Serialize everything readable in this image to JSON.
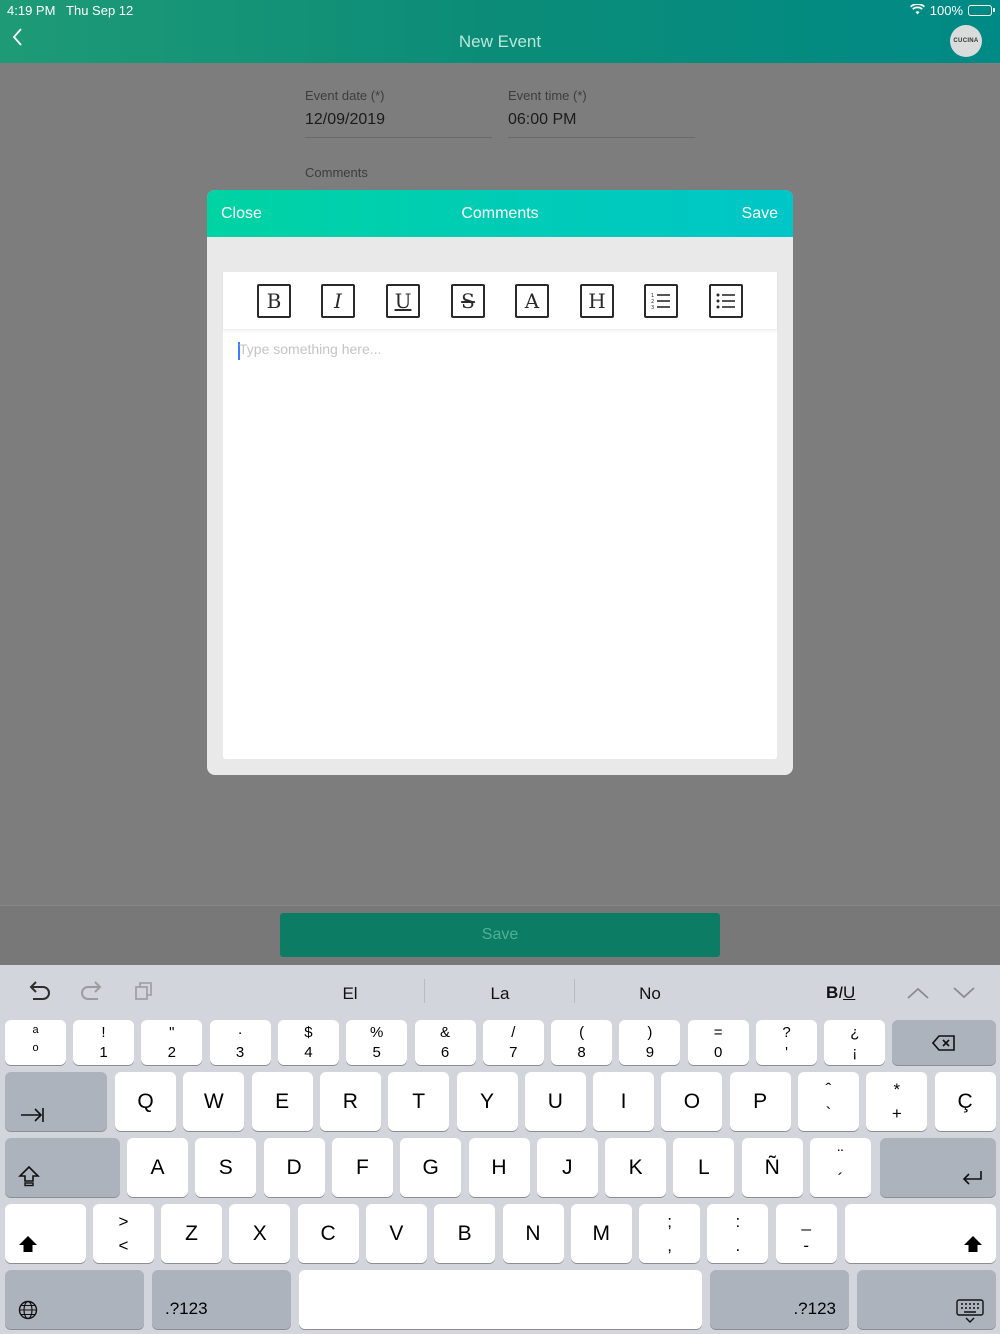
{
  "status_bar": {
    "time": "4:19 PM",
    "date": "Thu Sep 12",
    "battery": "100%"
  },
  "header": {
    "title": "New Event",
    "avatar_text": "CUCINA"
  },
  "form": {
    "event_date_label": "Event date (*)",
    "event_date_value": "12/09/2019",
    "event_time_label": "Event time (*)",
    "event_time_value": "06:00 PM",
    "comments_label": "Comments"
  },
  "modal": {
    "close_label": "Close",
    "title": "Comments",
    "save_label": "Save",
    "toolbar": [
      "B",
      "I",
      "U",
      "S",
      "A",
      "H",
      "ordered-list",
      "bullet-list"
    ],
    "placeholder": "Type something here..."
  },
  "bottom": {
    "save_label": "Save"
  },
  "keyboard": {
    "suggestions": [
      "El",
      "La",
      "No"
    ],
    "format_label": "BIU",
    "space_label": "",
    "numbers_label": ".?123",
    "row1": [
      {
        "top": "a\no",
        "bot": ""
      },
      {
        "top": "!",
        "bot": "1"
      },
      {
        "top": "\"",
        "bot": "2"
      },
      {
        "top": "·",
        "bot": "3"
      },
      {
        "top": "$",
        "bot": "4"
      },
      {
        "top": "%",
        "bot": "5"
      },
      {
        "top": "&",
        "bot": "6"
      },
      {
        "top": "/",
        "bot": "7"
      },
      {
        "top": "(",
        "bot": "8"
      },
      {
        "top": ")",
        "bot": "9"
      },
      {
        "top": "=",
        "bot": "0"
      },
      {
        "top": "?",
        "bot": "'"
      },
      {
        "top": "¿",
        "bot": "¡"
      }
    ],
    "row2": [
      "Q",
      "W",
      "E",
      "R",
      "T",
      "Y",
      "U",
      "I",
      "O",
      "P"
    ],
    "row2_extra": [
      {
        "top": "ˆ",
        "bot": "`"
      },
      {
        "top": "*",
        "bot": "+"
      },
      {
        "top": "",
        "bot": "Ç"
      }
    ],
    "row3": [
      "A",
      "S",
      "D",
      "F",
      "G",
      "H",
      "J",
      "K",
      "L",
      "Ñ"
    ],
    "row3_extra": {
      "top": "¨",
      "bot": "´"
    },
    "row4_extra_left": {
      "top": ">",
      "bot": "<"
    },
    "row4": [
      "Z",
      "X",
      "C",
      "V",
      "B",
      "N",
      "M"
    ],
    "row4_extra_right": [
      {
        "top": ";",
        "bot": ","
      },
      {
        "top": ":",
        "bot": "."
      },
      {
        "top": "_",
        "bot": "-"
      }
    ]
  }
}
